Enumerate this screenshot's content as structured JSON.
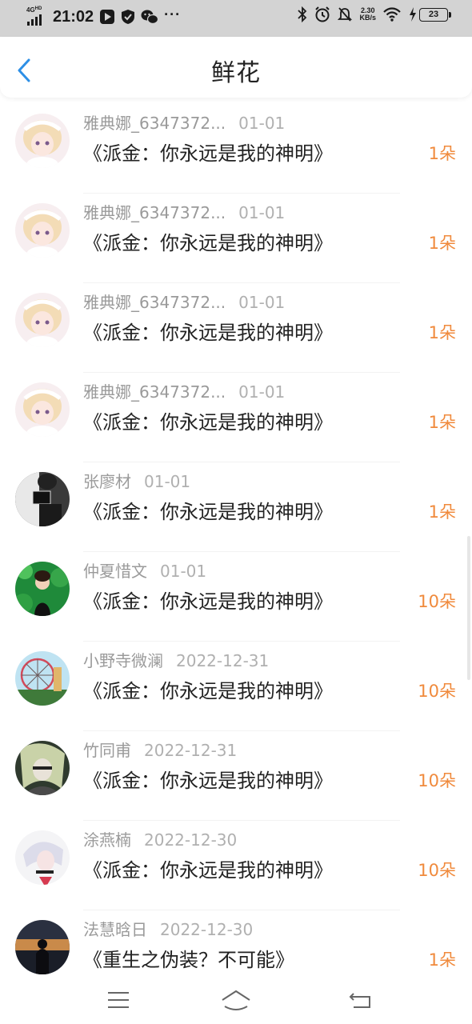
{
  "status_bar": {
    "network": "4G",
    "network_sup": "HD",
    "time": "21:02",
    "net_speed_value": "2.30",
    "net_speed_unit": "KB/s",
    "battery": "23",
    "icons": [
      "signal-icon",
      "video-app-icon",
      "shield-icon",
      "wechat-icon",
      "more-dots-icon",
      "bluetooth-icon",
      "alarm-icon",
      "mute-icon",
      "wifi-icon",
      "charging-icon",
      "battery-icon"
    ]
  },
  "header": {
    "title": "鲜花",
    "back_icon": "chevron-left-icon"
  },
  "colors": {
    "accent_blue": "#2d8fe6",
    "count_orange": "#f08a3c",
    "muted_text": "#9a9a9a",
    "status_bar_bg": "#d3d3d3"
  },
  "records": [
    {
      "user": "雅典娜_6347372...",
      "date": "01-01",
      "book": "《派金：你永远是我的神明》",
      "count": "1朵",
      "avatar": "anime-girl-avatar"
    },
    {
      "user": "雅典娜_6347372...",
      "date": "01-01",
      "book": "《派金：你永远是我的神明》",
      "count": "1朵",
      "avatar": "anime-girl-avatar"
    },
    {
      "user": "雅典娜_6347372...",
      "date": "01-01",
      "book": "《派金：你永远是我的神明》",
      "count": "1朵",
      "avatar": "anime-girl-avatar"
    },
    {
      "user": "雅典娜_6347372...",
      "date": "01-01",
      "book": "《派金：你永远是我的神明》",
      "count": "1朵",
      "avatar": "anime-girl-avatar"
    },
    {
      "user": "张廖材",
      "date": "01-01",
      "book": "《派金：你永远是我的神明》",
      "count": "1朵",
      "avatar": "dark-photo-avatar"
    },
    {
      "user": "仲夏惜文",
      "date": "01-01",
      "book": "《派金：你永远是我的神明》",
      "count": "10朵",
      "avatar": "green-photo-avatar"
    },
    {
      "user": "小野寺微澜",
      "date": "2022-12-31",
      "book": "《派金：你永远是我的神明》",
      "count": "10朵",
      "avatar": "ferris-wheel-avatar"
    },
    {
      "user": "竹同甫",
      "date": "2022-12-31",
      "book": "《派金：你永远是我的神明》",
      "count": "10朵",
      "avatar": "dark-anime-avatar"
    },
    {
      "user": "涂燕楠",
      "date": "2022-12-30",
      "book": "《派金：你永远是我的神明》",
      "count": "10朵",
      "avatar": "white-hair-avatar"
    },
    {
      "user": "法慧晗日",
      "date": "2022-12-30",
      "book": "《重生之伪装？不可能》",
      "count": "1朵",
      "avatar": "sunset-photo-avatar"
    }
  ],
  "nav_bar": {
    "menu_icon": "menu-icon",
    "home_icon": "home-icon",
    "back_icon": "back-arrow-icon"
  }
}
